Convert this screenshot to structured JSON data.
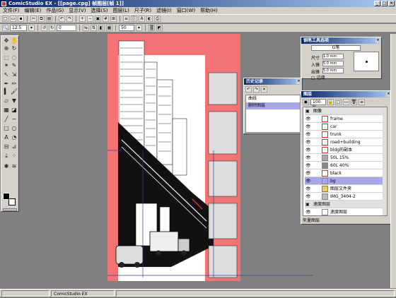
{
  "window": {
    "title": "ComicStudio EX - [[page.cpg] 帧图层[帧 1]]",
    "app_name": "ComicStudio EX"
  },
  "menu": [
    "文件(F)",
    "编辑(E)",
    "作品(G)",
    "显示(V)",
    "选择(S)",
    "图层(L)",
    "尺子(R)",
    "滤镜(I)",
    "窗口(W)",
    "帮助(H)"
  ],
  "toolbar2": {
    "zoom": "12.5",
    "angle": "0",
    "opacity": "50"
  },
  "history": {
    "title": "历史记录",
    "items": [
      "曲线",
      "删除图层"
    ],
    "selected_index": 1
  },
  "pen_panel": {
    "title": "钢笔工具选项",
    "pen": "G笔",
    "size_label": "尺寸",
    "size_value": "1.0 mm",
    "entry_label": "入锋",
    "entry_value": "5.0 mm",
    "exit_label": "出锋",
    "exit_value": "5.0 mm",
    "check_label": "□ 边缘"
  },
  "layers": {
    "title": "图层",
    "opacity": "100 %",
    "groups": {
      "image": "图像",
      "vector": "矢量图层"
    },
    "items": [
      {
        "name": "frame",
        "type": "vector"
      },
      {
        "name": "car",
        "type": "vector"
      },
      {
        "name": "trunk",
        "type": "vector"
      },
      {
        "name": "road+building",
        "type": "vector"
      },
      {
        "name": "bldg的副本",
        "type": "raster"
      },
      {
        "name": "50L 15%",
        "type": "tone"
      },
      {
        "name": "60L 40%",
        "type": "tone"
      },
      {
        "name": "black",
        "type": "raster"
      },
      {
        "name": "bg",
        "type": "raster"
      },
      {
        "name": "图层文件夹",
        "type": "folder"
      },
      {
        "name": "IMG_3404-2",
        "type": "raster"
      }
    ],
    "footer_item": "速度图层",
    "footer_label": "矢量图层",
    "selected": "bg"
  },
  "statusbar": {
    "text": "ComicStudio EX"
  }
}
